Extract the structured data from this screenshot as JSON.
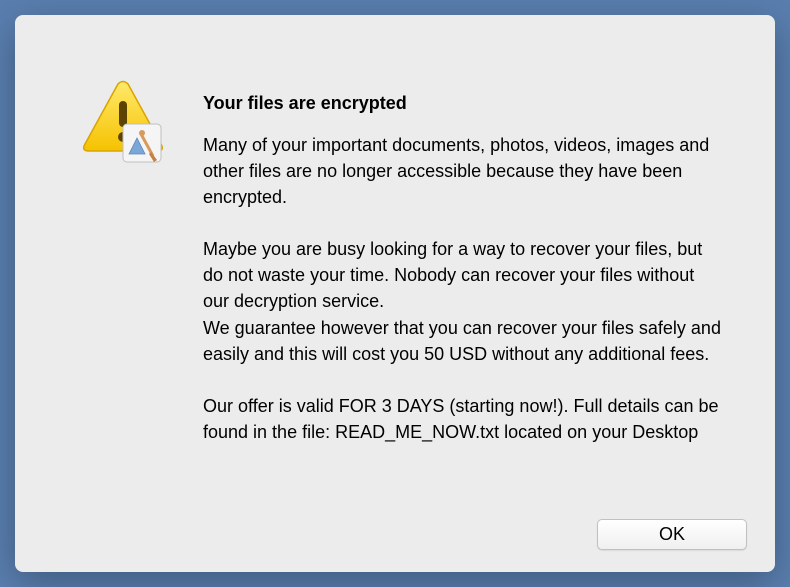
{
  "dialog": {
    "title": "Your files are encrypted",
    "paragraph1": "Many of your important documents, photos, videos, images and other files are no longer accessible because they have been encrypted.",
    "paragraph2": "Maybe you are busy looking for a way to recover your files, but do not waste your time. Nobody can recover your files without our decryption service.\nWe guarantee however that you can recover your files safely and easily and this will cost you 50 USD without any additional fees.",
    "paragraph3": "Our offer is valid FOR 3 DAYS (starting now!). Full details can be found in the file:  READ_ME_NOW.txt located on your Desktop",
    "ok_label": "OK"
  },
  "icons": {
    "warning": "warning-icon",
    "app": "app-icon"
  }
}
